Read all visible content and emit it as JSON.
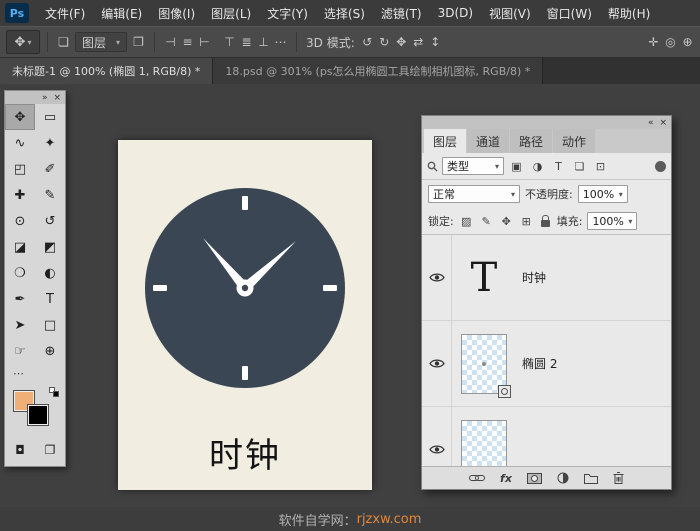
{
  "colors": {
    "clock_face": "#3a4653",
    "paper": "#f1eee1",
    "fg_swatch": "#f0af76",
    "accent": "#e0883f"
  },
  "menubar": {
    "logo": "Ps",
    "items": [
      "文件(F)",
      "编辑(E)",
      "图像(I)",
      "图层(L)",
      "文字(Y)",
      "选择(S)",
      "滤镜(T)",
      "3D(D)",
      "视图(V)",
      "窗口(W)",
      "帮助(H)"
    ]
  },
  "options": {
    "tool_glyph": "✥",
    "caret": "▾",
    "layers_glyph": "❏",
    "target": "图层",
    "transform_glyph": "❐",
    "align": [
      "⊣",
      "≡",
      "⊢",
      "⊤",
      "≣",
      "⊥"
    ],
    "more": "⋯",
    "mode_label": "3D 模式:",
    "mode_icons": [
      "↺",
      "↻",
      "✥",
      "⇄",
      "↕"
    ],
    "extra_icons": [
      "✛",
      "◎",
      "⊕"
    ]
  },
  "tabs": {
    "doc1": "未标题-1 @ 100% (椭圆 1, RGB/8) *",
    "doc2": "18.psd @ 301% (ps怎么用椭圆工具绘制相机图标, RGB/8) *"
  },
  "toolbox": {
    "collapse": "»",
    "close": "×",
    "glyphs": [
      "✥",
      "▭",
      "∿",
      "✦",
      "◰",
      "✐",
      "✚",
      "✎",
      "⊙",
      "↺",
      "◪",
      "◩",
      "❍",
      "◐",
      "✒",
      "T",
      "➤",
      "□",
      "☞",
      "⊕"
    ],
    "more": "⋯",
    "quick_mask": "◘",
    "screen_mode": "❐"
  },
  "canvas": {
    "caption": "时钟"
  },
  "panel": {
    "collapse": "«",
    "close": "×",
    "tabs": [
      "图层",
      "通道",
      "路径",
      "动作"
    ],
    "type_filter": "类型",
    "caret": "▾",
    "filter_icons": [
      "▣",
      "◑",
      "T",
      "❏",
      "⊡"
    ],
    "blend_mode": "正常",
    "opacity_label": "不透明度:",
    "opacity_value": "100%",
    "lock_label": "锁定:",
    "lock_icons": [
      "▨",
      "✎",
      "✥",
      "⊞"
    ],
    "fill_label": "填充:",
    "fill_value": "100%",
    "layers": [
      {
        "name": "时钟",
        "thumb": "T"
      },
      {
        "name": "椭圆 2"
      },
      {
        "name": ""
      }
    ],
    "fx_label": "fx"
  },
  "sitebar": {
    "prefix": "软件自学网：",
    "domain": "rjzxw.com"
  }
}
